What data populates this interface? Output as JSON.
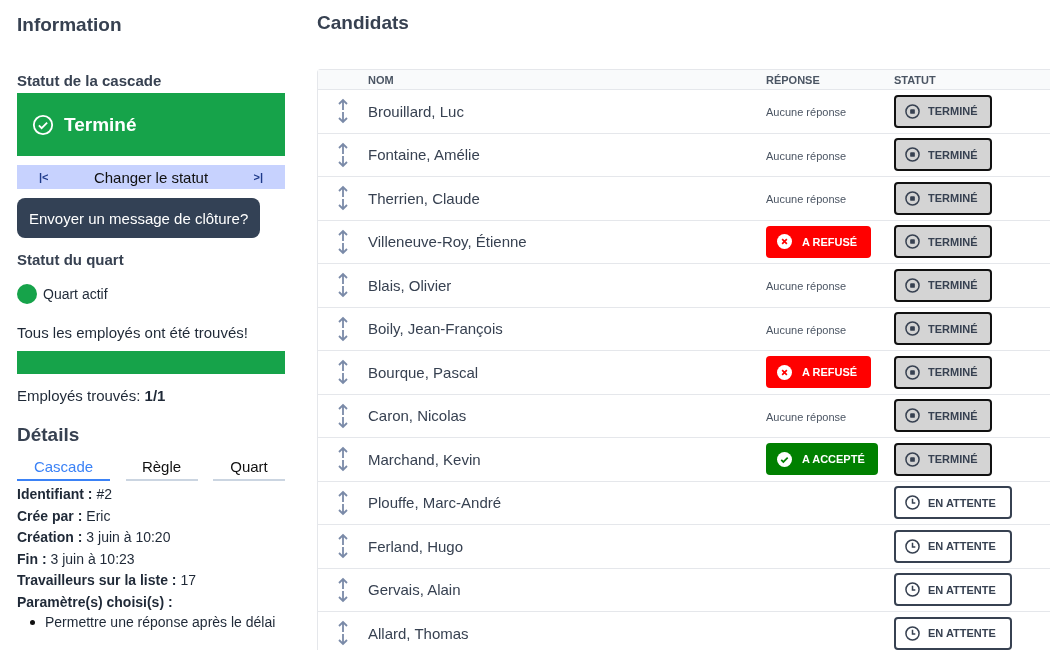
{
  "sidebar": {
    "title": "Information",
    "cascade_status": {
      "heading": "Statut de la cascade",
      "label": "Terminé",
      "kind": "done"
    },
    "change_status": {
      "prev": "|<",
      "label": "Changer le statut",
      "next": ">|"
    },
    "closing_button": "Envoyer un message de clôture?",
    "shift_status": {
      "heading": "Statut du quart",
      "label": "Quart actif",
      "active": true
    },
    "found_message": "Tous les employés ont été trouvés!",
    "progress": {
      "level": 1
    },
    "found_count": {
      "label": "Employés trouvés:",
      "value": "1/1"
    },
    "details_title": "Détails",
    "tabs": [
      {
        "label": "Cascade",
        "selected": true
      },
      {
        "label": "Règle",
        "selected": false
      },
      {
        "label": "Quart",
        "selected": false
      }
    ],
    "details": [
      {
        "label": "Identifiant :",
        "value": "#2"
      },
      {
        "label": "Crée par :",
        "value": "Eric"
      },
      {
        "label": "Création :",
        "value": "3 juin à 10:20"
      },
      {
        "label": "Fin :",
        "value": "3 juin à 10:23"
      },
      {
        "label": "Travailleurs sur la liste :",
        "value": "17"
      },
      {
        "label": "Paramètre(s) choisi(s) :"
      }
    ],
    "parameters": [
      "Permettre une réponse après le délai"
    ]
  },
  "main": {
    "title": "Candidats",
    "columns": [
      "NOM",
      "RÉPONSE",
      "STATUT"
    ],
    "rows": [
      {
        "name": "Brouillard, Luc",
        "response": {
          "kind": "none",
          "label": "Aucune réponse"
        },
        "status": {
          "kind": "done",
          "label": "TERMINÉ"
        }
      },
      {
        "name": "Fontaine, Amélie",
        "response": {
          "kind": "none",
          "label": "Aucune réponse"
        },
        "status": {
          "kind": "done",
          "label": "TERMINÉ"
        }
      },
      {
        "name": "Therrien, Claude",
        "response": {
          "kind": "none",
          "label": "Aucune réponse"
        },
        "status": {
          "kind": "done",
          "label": "TERMINÉ"
        }
      },
      {
        "name": "Villeneuve-Roy, Étienne",
        "response": {
          "kind": "refused",
          "label": "A REFUSÉ"
        },
        "status": {
          "kind": "done",
          "label": "TERMINÉ"
        }
      },
      {
        "name": "Blais, Olivier",
        "response": {
          "kind": "none",
          "label": "Aucune réponse"
        },
        "status": {
          "kind": "done",
          "label": "TERMINÉ"
        }
      },
      {
        "name": "Boily, Jean-François",
        "response": {
          "kind": "none",
          "label": "Aucune réponse"
        },
        "status": {
          "kind": "done",
          "label": "TERMINÉ"
        }
      },
      {
        "name": "Bourque, Pascal",
        "response": {
          "kind": "refused",
          "label": "A REFUSÉ"
        },
        "status": {
          "kind": "done",
          "label": "TERMINÉ"
        }
      },
      {
        "name": "Caron, Nicolas",
        "response": {
          "kind": "none",
          "label": "Aucune réponse"
        },
        "status": {
          "kind": "done",
          "label": "TERMINÉ"
        }
      },
      {
        "name": "Marchand, Kevin",
        "response": {
          "kind": "accepted",
          "label": "A ACCEPTÉ"
        },
        "status": {
          "kind": "done",
          "label": "TERMINÉ"
        }
      },
      {
        "name": "Plouffe, Marc-André",
        "status": {
          "kind": "pending",
          "label": "EN ATTENTE"
        }
      },
      {
        "name": "Ferland, Hugo",
        "status": {
          "kind": "pending",
          "label": "EN ATTENTE"
        }
      },
      {
        "name": "Gervais, Alain",
        "status": {
          "kind": "pending",
          "label": "EN ATTENTE"
        }
      },
      {
        "name": "Allard, Thomas",
        "status": {
          "kind": "pending",
          "label": "EN ATTENTE"
        }
      }
    ]
  }
}
